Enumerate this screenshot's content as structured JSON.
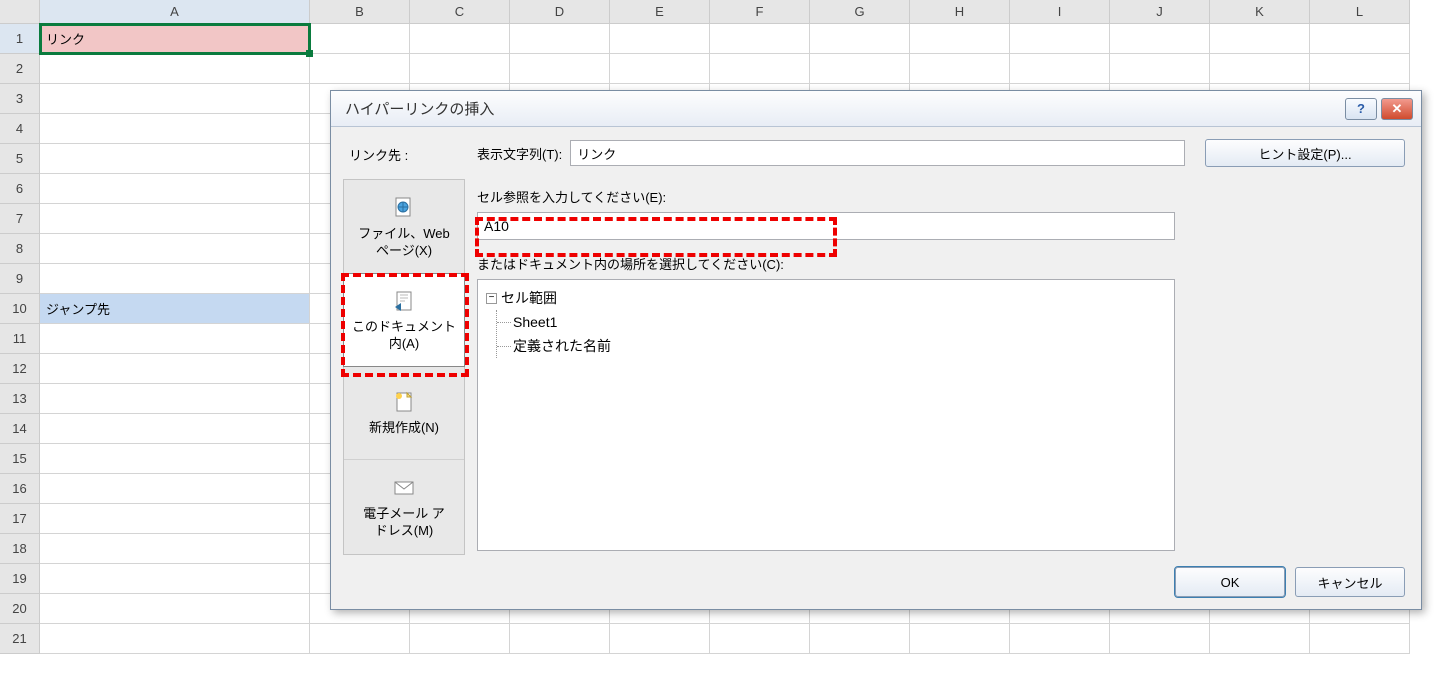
{
  "columns": [
    "A",
    "B",
    "C",
    "D",
    "E",
    "F",
    "G",
    "H",
    "I",
    "J",
    "K",
    "L"
  ],
  "rows": [
    1,
    2,
    3,
    4,
    5,
    6,
    7,
    8,
    9,
    10,
    11,
    12,
    13,
    14,
    15,
    16,
    17,
    18,
    19,
    20,
    21
  ],
  "cells": {
    "a1": "リンク",
    "a10": "ジャンプ先"
  },
  "dialog": {
    "title": "ハイパーリンクの挿入",
    "help_glyph": "?",
    "close_glyph": "✕",
    "link_to_label": "リンク先 :",
    "display_text_label": "表示文字列(T):",
    "display_text_value": "リンク",
    "hint_button": "ヒント設定(P)...",
    "cell_ref_label": "セル参照を入力してください(E):",
    "cell_ref_value": "A10",
    "select_place_label": "またはドキュメント内の場所を選択してください(C):",
    "tree": {
      "root1": "セル範囲",
      "root1_expand": "−",
      "leaf1": "Sheet1",
      "root2": "定義された名前"
    },
    "nav": {
      "file_web_top": "ファイル、Web",
      "file_web_bottom": "ページ(X)",
      "this_doc_top": "このドキュメント",
      "this_doc_bottom": "内(A)",
      "new_doc": "新規作成(N)",
      "email_top": "電子メール ア",
      "email_bottom": "ドレス(M)"
    },
    "ok": "OK",
    "cancel": "キャンセル"
  }
}
